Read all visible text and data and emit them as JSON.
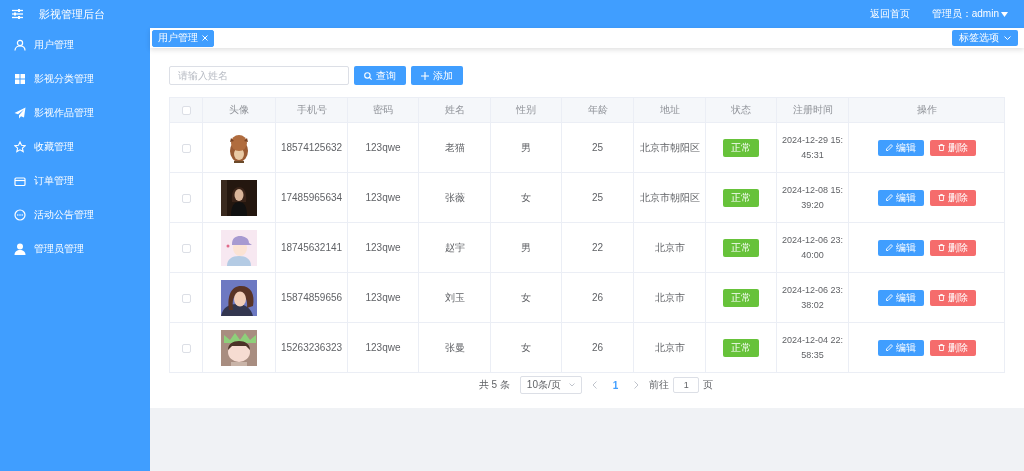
{
  "header": {
    "title": "影视管理后台",
    "links": [
      "返回首页"
    ],
    "user": "管理员：admin"
  },
  "sidebar": {
    "items": [
      {
        "label": "用户管理"
      },
      {
        "label": "影视分类管理"
      },
      {
        "label": "影视作品管理"
      },
      {
        "label": "收藏管理"
      },
      {
        "label": "订单管理"
      },
      {
        "label": "活动公告管理"
      },
      {
        "label": "管理员管理"
      }
    ]
  },
  "tabs": [
    {
      "label": "用户管理",
      "selected": true
    }
  ],
  "tab_options": "标签选项",
  "search": {
    "placeholder": "请输入姓名",
    "buttons": [
      "查询",
      "添加"
    ]
  },
  "table": {
    "select_all": {
      "checked": false
    },
    "columns": [
      "头像",
      "手机号",
      "密码",
      "姓名",
      "性别",
      "年龄",
      "地址",
      "状态",
      "注册时间",
      "操作"
    ],
    "rows": [
      {
        "checked": false,
        "phone": "18574125632",
        "password": "123qwe",
        "name": "老猫",
        "gender": "男",
        "age": "25",
        "address": "北京市朝阳区",
        "status": "正常",
        "registered": "2024-12-29 15:45:31",
        "actions": [
          "编辑",
          "删除"
        ]
      },
      {
        "checked": false,
        "phone": "17485965634",
        "password": "123qwe",
        "name": "张薇",
        "gender": "女",
        "age": "25",
        "address": "北京市朝阳区",
        "status": "正常",
        "registered": "2024-12-08 15:39:20",
        "actions": [
          "编辑",
          "删除"
        ]
      },
      {
        "checked": false,
        "phone": "18745632141",
        "password": "123qwe",
        "name": "赵宇",
        "gender": "男",
        "age": "22",
        "address": "北京市",
        "status": "正常",
        "registered": "2024-12-06 23:40:00",
        "actions": [
          "编辑",
          "删除"
        ]
      },
      {
        "checked": false,
        "phone": "15874859656",
        "password": "123qwe",
        "name": "刘玉",
        "gender": "女",
        "age": "26",
        "address": "北京市",
        "status": "正常",
        "registered": "2024-12-06 23:38:02",
        "actions": [
          "编辑",
          "删除"
        ]
      },
      {
        "checked": false,
        "phone": "15263236323",
        "password": "123qwe",
        "name": "张曼",
        "gender": "女",
        "age": "26",
        "address": "北京市",
        "status": "正常",
        "registered": "2024-12-04 22:58:35",
        "actions": [
          "编辑",
          "删除"
        ]
      }
    ]
  },
  "pagination": {
    "total": "共 5 条",
    "page_size": "10条/页",
    "pages": [
      {
        "label": "1",
        "selected": true
      }
    ],
    "goto_label": "前往",
    "goto_value": "1",
    "page_unit": "页"
  }
}
